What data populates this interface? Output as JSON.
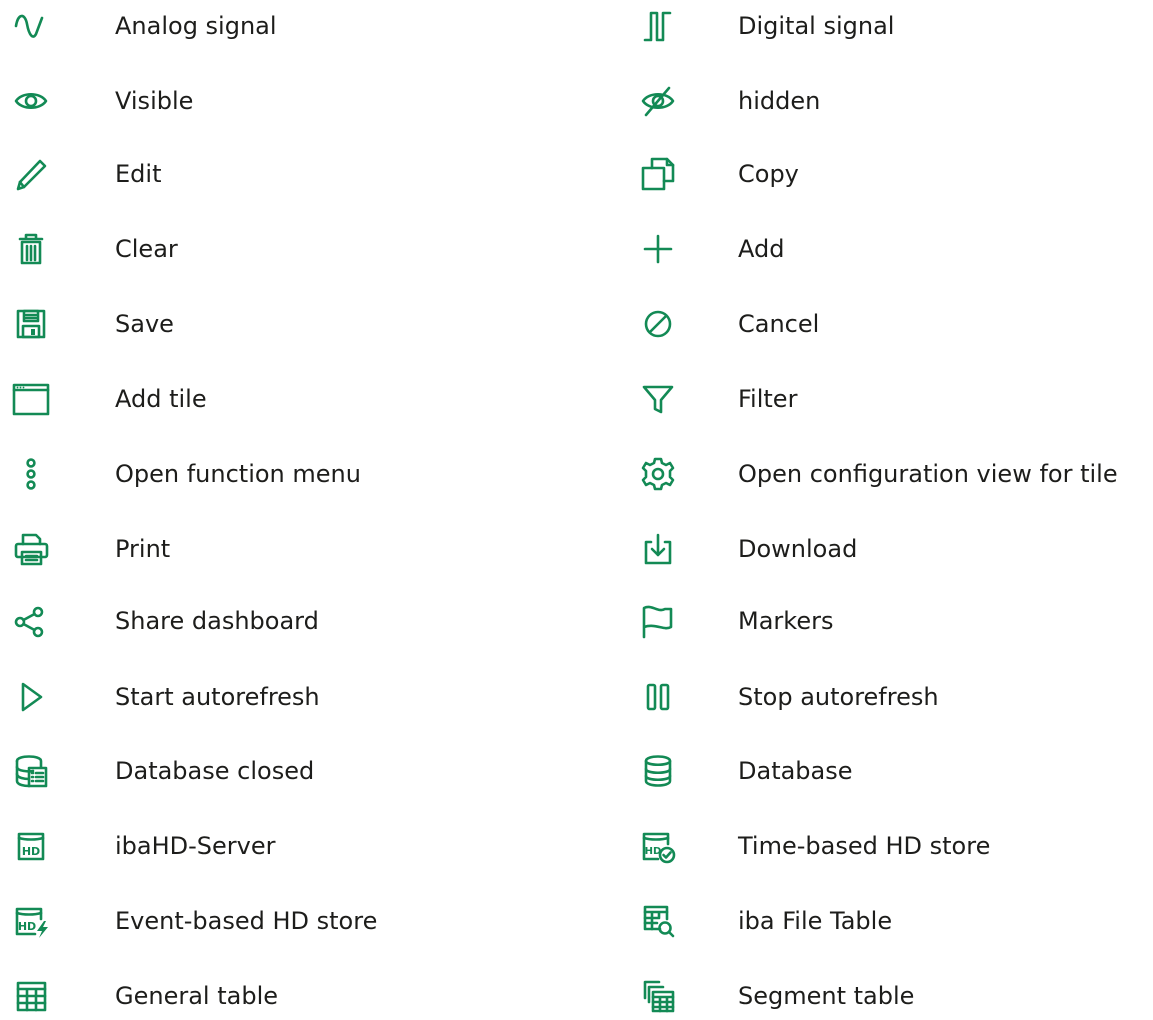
{
  "left_items": [
    {
      "label": "Analog signal",
      "icon": "analog-signal-icon"
    },
    {
      "label": "Visible",
      "icon": "eye-icon"
    },
    {
      "label": "Edit",
      "icon": "pencil-icon"
    },
    {
      "label": "Clear",
      "icon": "trash-icon"
    },
    {
      "label": "Save",
      "icon": "floppy-disk-icon"
    },
    {
      "label": "Add tile",
      "icon": "window-icon"
    },
    {
      "label": "Open function menu",
      "icon": "vertical-dots-icon"
    },
    {
      "label": "Print",
      "icon": "printer-icon"
    },
    {
      "label": "Share dashboard",
      "icon": "share-icon"
    },
    {
      "label": "Start autorefresh",
      "icon": "play-icon"
    },
    {
      "label": "Database closed",
      "icon": "database-closed-icon"
    },
    {
      "label": "ibaHD-Server",
      "icon": "hd-server-icon"
    },
    {
      "label": "Event-based HD store",
      "icon": "hd-event-store-icon"
    },
    {
      "label": "General table",
      "icon": "table-icon"
    }
  ],
  "right_items": [
    {
      "label": "Digital signal",
      "icon": "digital-signal-icon"
    },
    {
      "label": "hidden",
      "icon": "eye-slash-icon"
    },
    {
      "label": "Copy",
      "icon": "copy-icon"
    },
    {
      "label": "Add",
      "icon": "plus-icon"
    },
    {
      "label": "Cancel",
      "icon": "cancel-icon"
    },
    {
      "label": "Filter",
      "icon": "filter-icon"
    },
    {
      "label": "Open configuration view for tile",
      "icon": "gear-icon"
    },
    {
      "label": "Download",
      "icon": "download-icon"
    },
    {
      "label": "Markers",
      "icon": "flag-icon"
    },
    {
      "label": "Stop autorefresh",
      "icon": "pause-icon"
    },
    {
      "label": "Database",
      "icon": "database-icon"
    },
    {
      "label": "Time-based HD store",
      "icon": "hd-time-store-icon"
    },
    {
      "label": "iba File Table",
      "icon": "file-table-search-icon"
    },
    {
      "label": "Segment table",
      "icon": "segment-table-icon"
    }
  ],
  "icon_text": {
    "hd": "HD"
  },
  "colors": {
    "icon_green": "#138a55",
    "text": "#1d1d1b",
    "background": "#ffffff"
  }
}
